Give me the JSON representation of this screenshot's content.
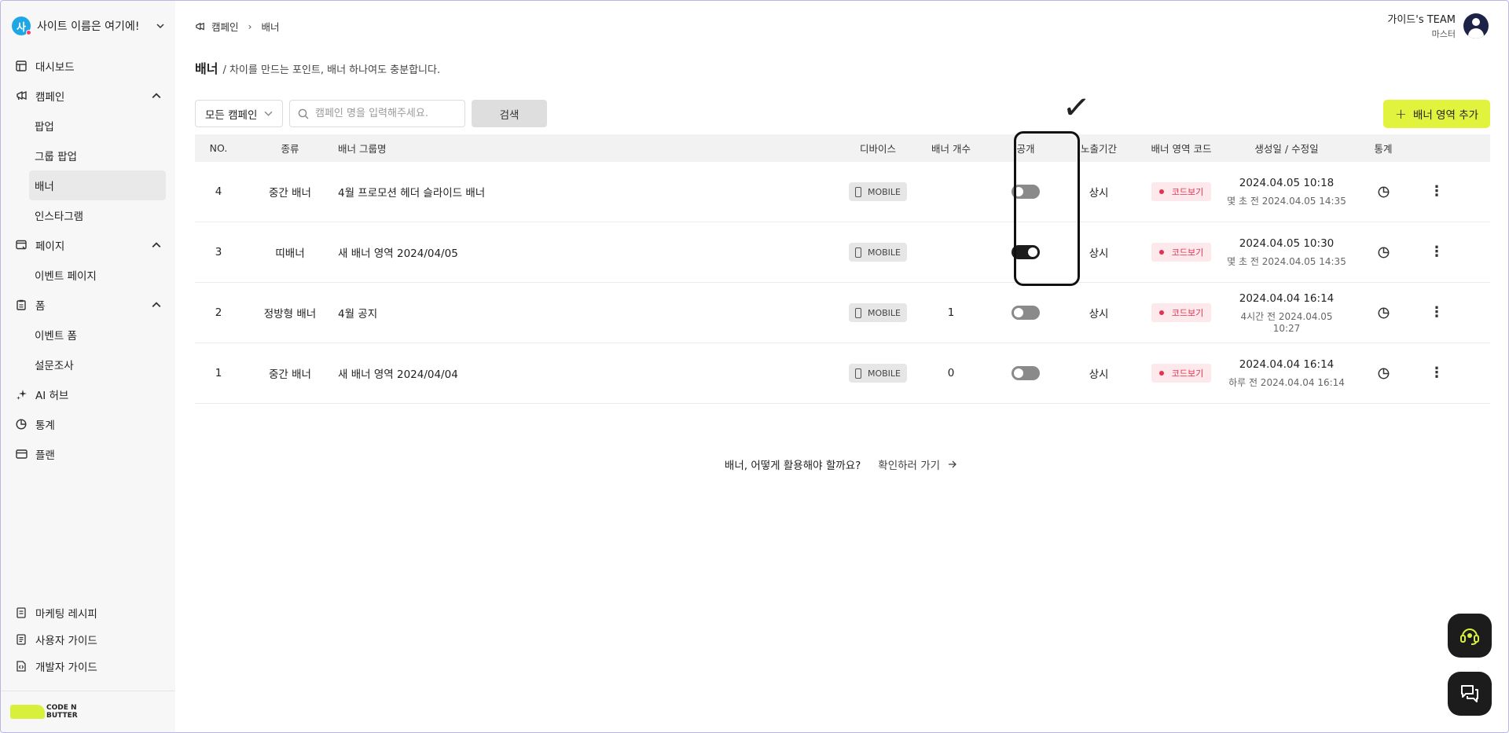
{
  "sidebar": {
    "site_avatar": "사",
    "site_name": "사이트 이름은 여기에!",
    "items": [
      {
        "label": "대시보드",
        "icon": "layout-icon"
      },
      {
        "label": "캠페인",
        "icon": "megaphone-icon",
        "expanded": true,
        "children": [
          "팝업",
          "그룹 팝업",
          "배너",
          "인스타그램"
        ]
      },
      {
        "label": "페이지",
        "icon": "browser-icon",
        "expanded": true,
        "children": [
          "이벤트 페이지"
        ]
      },
      {
        "label": "폼",
        "icon": "clipboard-icon",
        "expanded": true,
        "children": [
          "이벤트 폼",
          "설문조사"
        ]
      },
      {
        "label": "AI 허브",
        "icon": "sparkle-icon"
      },
      {
        "label": "통계",
        "icon": "pie-chart-icon"
      },
      {
        "label": "플랜",
        "icon": "card-icon"
      }
    ],
    "active_item": "배너",
    "bottom_items": [
      "마케팅 레시피",
      "사용자 가이드",
      "개발자 가이드"
    ],
    "brand": [
      "CODE N",
      "BUTTER"
    ],
    "brand_color": "#d8f03b"
  },
  "breadcrumb": [
    "캠페인",
    "배너"
  ],
  "team": {
    "name": "가이드's TEAM",
    "role": "마스터"
  },
  "page": {
    "title": "배너",
    "description": "/ 차이를 만드는 포인트, 배너 하나여도 충분합니다."
  },
  "toolbar": {
    "campaign_select": "모든 캠페인",
    "search_placeholder": "캠페인 명을 입력해주세요.",
    "search_label": "검색",
    "add_label": "배너 영역 추가",
    "accent": "#e2f33d"
  },
  "table": {
    "headers": {
      "no": "NO.",
      "type": "종류",
      "name": "배너 그룹명",
      "device": "디바이스",
      "count": "배너 개수",
      "public": "공개",
      "period": "노출기간",
      "code": "배너 영역 코드",
      "date": "생성일 / 수정일",
      "stats": "통계"
    },
    "rows": [
      {
        "no": "4",
        "type": "중간 배너",
        "name": "4월 프로모션 헤더 슬라이드 배너",
        "device": "MOBILE",
        "count": "",
        "public": false,
        "period": "상시",
        "code": "코드보기",
        "created": "2024.04.05 10:18",
        "modified": "몇 초 전 2024.04.05 14:35"
      },
      {
        "no": "3",
        "type": "띠배너",
        "name": "새 배너 영역 2024/04/05",
        "device": "MOBILE",
        "count": "",
        "public": true,
        "period": "상시",
        "code": "코드보기",
        "created": "2024.04.05 10:30",
        "modified": "몇 초 전 2024.04.05 14:35"
      },
      {
        "no": "2",
        "type": "정방형 배너",
        "name": "4월 공지",
        "device": "MOBILE",
        "count": "1",
        "public": false,
        "period": "상시",
        "code": "코드보기",
        "created": "2024.04.04 16:14",
        "modified": "4시간 전 2024.04.05 10:27"
      },
      {
        "no": "1",
        "type": "중간 배너",
        "name": "새 배너 영역 2024/04/04",
        "device": "MOBILE",
        "count": "0",
        "public": false,
        "period": "상시",
        "code": "코드보기",
        "created": "2024.04.04 16:14",
        "modified": "하루 전 2024.04.04 16:14"
      }
    ]
  },
  "annotation": {
    "mark": "✓"
  },
  "help": {
    "question": "배너, 어떻게 활용해야 할까요?",
    "link": "확인하러 가기"
  }
}
